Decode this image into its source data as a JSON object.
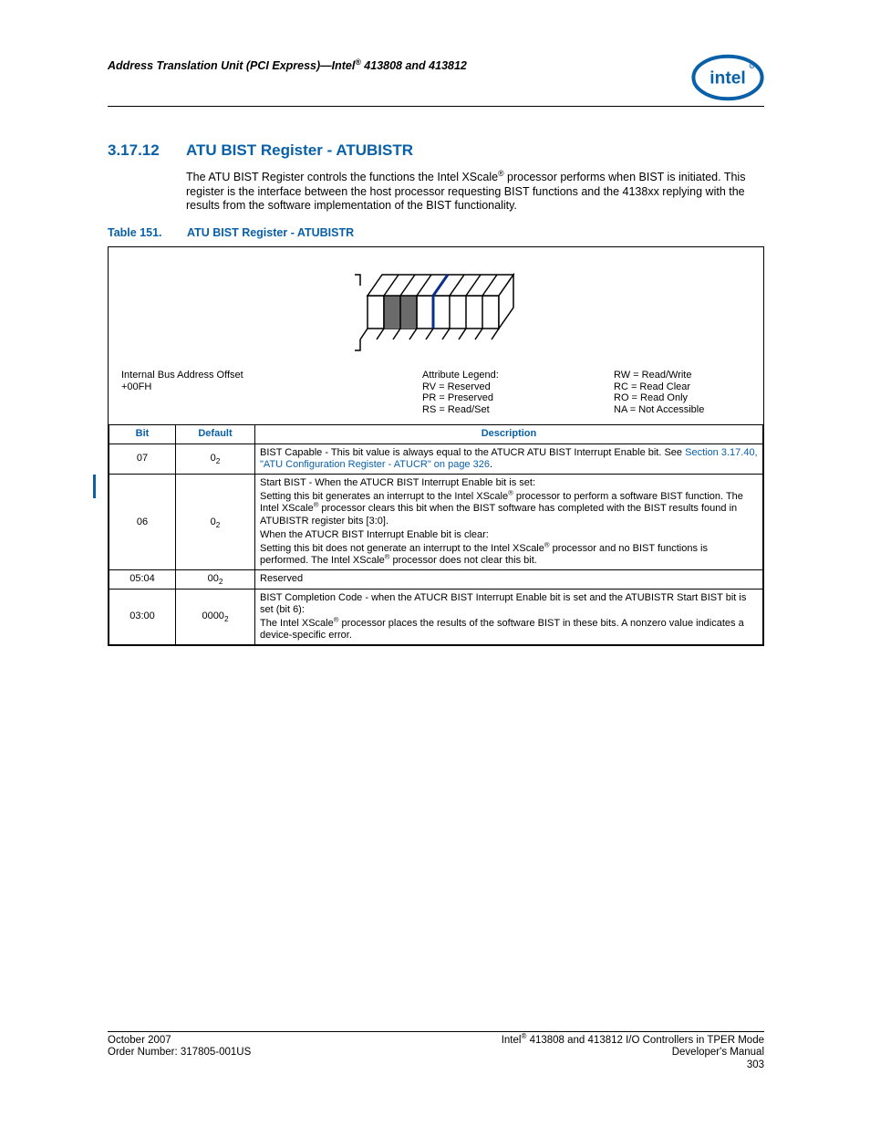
{
  "header": {
    "running_title": "Address Translation Unit (PCI Express)—Intel® 413808 and 413812"
  },
  "section": {
    "number": "3.17.12",
    "title": "ATU BIST Register - ATUBISTR",
    "body": "The ATU BIST Register controls the functions the Intel XScale® processor performs when BIST is initiated. This register is the interface between the host processor requesting BIST functions and the 4138xx replying with the results from the software implementation of the BIST functionality."
  },
  "table_caption": {
    "label": "Table 151.",
    "text": "ATU BIST Register - ATUBISTR"
  },
  "figure": {
    "offset_label": "Internal Bus Address Offset",
    "offset_value": "+00FH",
    "legend_title": "Attribute Legend:",
    "legend_left": [
      "RV = Reserved",
      "PR = Preserved",
      "RS = Read/Set"
    ],
    "legend_right": [
      "RW = Read/Write",
      "RC = Read Clear",
      "RO = Read Only",
      "NA = Not Accessible"
    ]
  },
  "reg_table": {
    "headers": {
      "bit": "Bit",
      "default": "Default",
      "desc": "Description"
    },
    "rows": [
      {
        "bit": "07",
        "default_val": "0",
        "default_base": "2",
        "desc_pre": "BIST Capable - This bit value is always equal to the ATUCR ATU BIST Interrupt Enable bit. See ",
        "link": "Section 3.17.40, \"ATU Configuration Register - ATUCR\" on page 326",
        "desc_post": "."
      },
      {
        "bit": "06",
        "default_val": "0",
        "default_base": "2",
        "desc_lines": [
          "Start BIST - When the ATUCR BIST Interrupt Enable bit is set:",
          "Setting this bit generates an interrupt to the Intel XScale® processor to perform a software BIST function. The Intel XScale® processor clears this bit when the BIST software has completed with the BIST results found in ATUBISTR register bits [3:0].",
          "When the ATUCR BIST Interrupt Enable bit is clear:",
          "Setting this bit does not generate an interrupt to the Intel XScale® processor and no BIST functions is performed. The Intel XScale® processor does not clear this bit."
        ]
      },
      {
        "bit": "05:04",
        "default_val": "00",
        "default_base": "2",
        "desc_plain": "Reserved"
      },
      {
        "bit": "03:00",
        "default_val": "0000",
        "default_base": "2",
        "desc_lines": [
          "BIST Completion Code - when the ATUCR BIST Interrupt Enable bit is set and the ATUBISTR Start BIST bit is set (bit 6):",
          "The Intel XScale® processor places the results of the software BIST in these bits. A nonzero value indicates a device-specific error."
        ]
      }
    ]
  },
  "footer": {
    "left1": "October 2007",
    "left2": "Order Number: 317805-001US",
    "right1": "Intel® 413808 and 413812 I/O Controllers in TPER Mode",
    "right2": "Developer's Manual",
    "page": "303"
  }
}
